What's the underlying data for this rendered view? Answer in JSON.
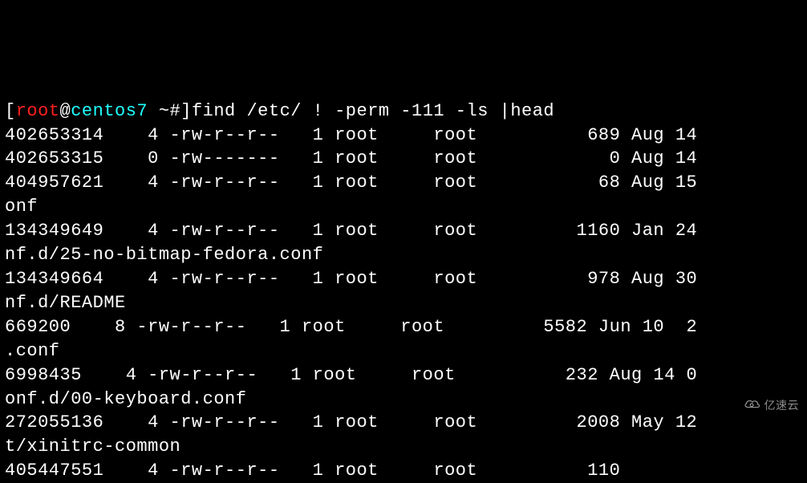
{
  "prompt": {
    "user": "root",
    "host": "centos7",
    "path": "~#",
    "command": "find /etc/ ! -perm -111 -ls |head"
  },
  "lines": {
    "l1": "402653314    4 -rw-r--r--   1 root     root          689 Aug 14",
    "l2": "402653315    0 -rw-------   1 root     root            0 Aug 14",
    "l3": "404957621    4 -rw-r--r--   1 root     root           68 Aug 15",
    "l4": "onf",
    "l5": "134349649    4 -rw-r--r--   1 root     root         1160 Jan 24",
    "l6": "nf.d/25-no-bitmap-fedora.conf",
    "l7": "134349664    4 -rw-r--r--   1 root     root          978 Aug 30",
    "l8": "nf.d/README",
    "l9": "669200    8 -rw-r--r--   1 root     root         5582 Jun 10  2",
    "l10": ".conf",
    "l11": "6998435    4 -rw-r--r--   1 root     root          232 Aug 14 0",
    "l12": "onf.d/00-keyboard.conf",
    "l13": "272055136    4 -rw-r--r--   1 root     root         2008 May 12",
    "l14": "t/xinitrc-common",
    "l15": "405447551    4 -rw-r--r--   1 root     root          110"
  },
  "watermark": {
    "text": "亿速云"
  }
}
